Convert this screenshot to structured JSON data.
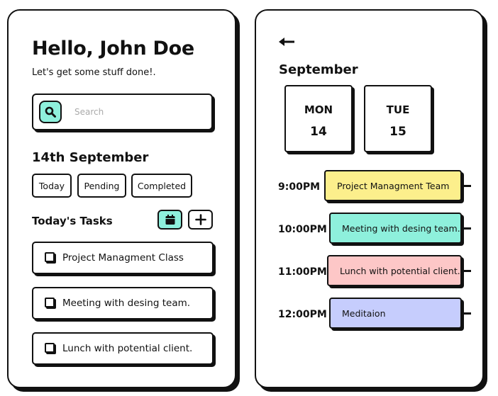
{
  "greeting": "Hello, John Doe",
  "subtitle": "Let's get some stuff done!.",
  "search": {
    "placeholder": "Search",
    "value": ""
  },
  "date_heading": "14th September",
  "filters": [
    "Today",
    "Pending",
    "Completed"
  ],
  "tasks_heading": "Today's Tasks",
  "tasks": [
    {
      "label": "Project Managment Class"
    },
    {
      "label": "Meeting with desing team."
    },
    {
      "label": "Lunch with potential client."
    }
  ],
  "schedule": {
    "month": "September",
    "days": [
      {
        "name": "MON",
        "number": "14"
      },
      {
        "name": "TUE",
        "number": "15"
      }
    ],
    "events": [
      {
        "time": "9:00PM",
        "title": "Project Managment Team",
        "color": "#fcef8c"
      },
      {
        "time": "10:00PM",
        "title": "Meeting with desing team.",
        "color": "#8ef0dc"
      },
      {
        "time": "11:00PM",
        "title": "Lunch with potential client.",
        "color": "#fdc7c7"
      },
      {
        "time": "12:00PM",
        "title": "Meditaion",
        "color": "#c6cdfd"
      }
    ]
  },
  "colors": {
    "accent": "#8ef0dc",
    "border": "#111111"
  }
}
